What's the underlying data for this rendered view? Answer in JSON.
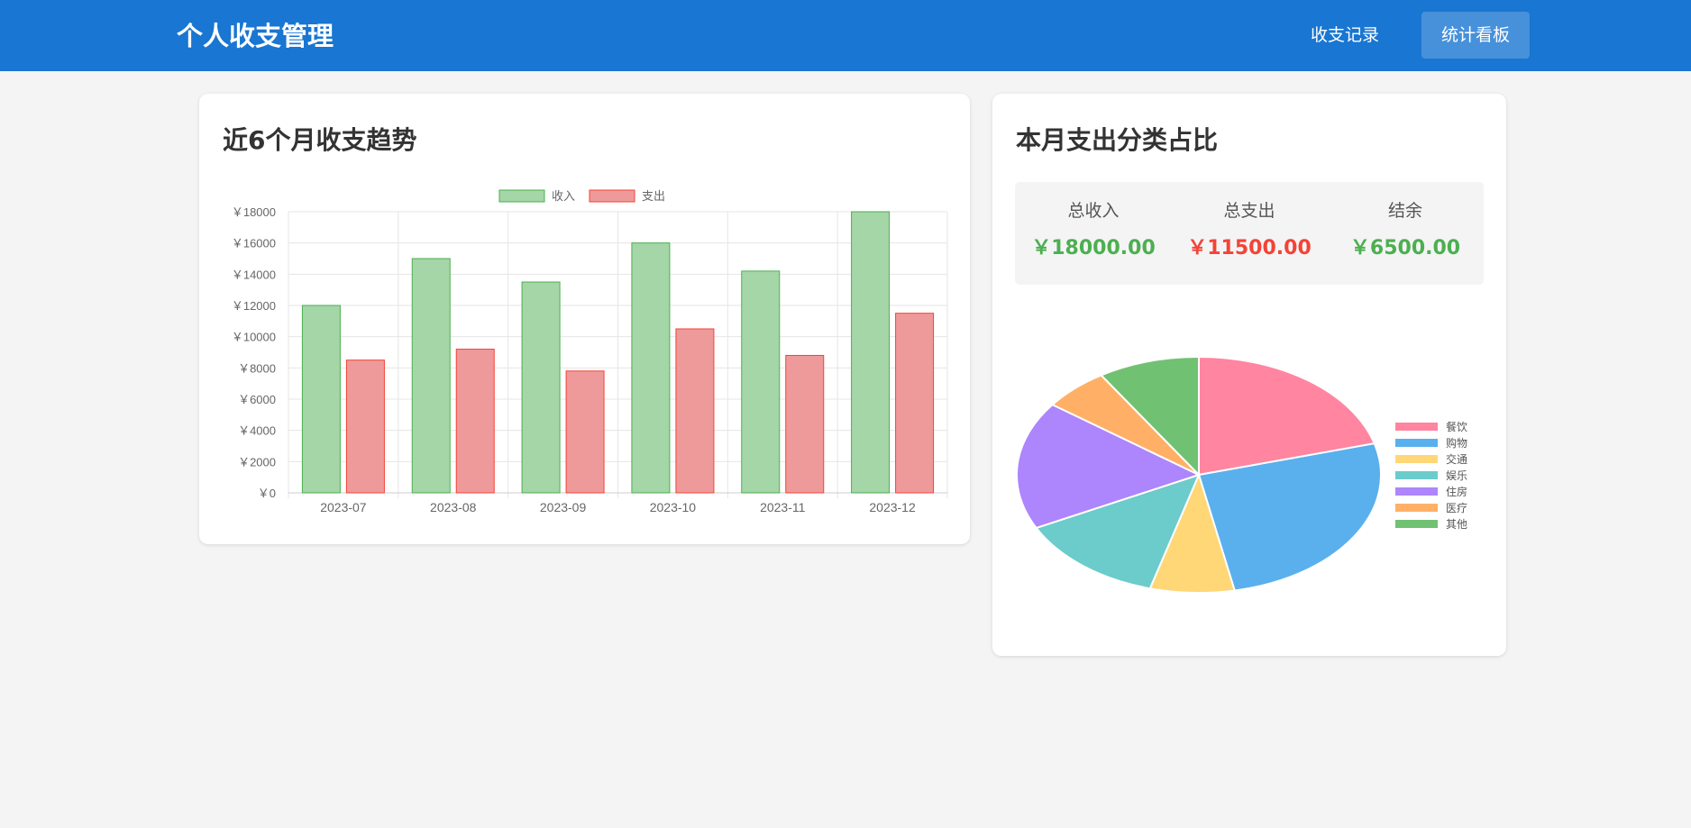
{
  "app": {
    "title": "个人收支管理",
    "nav": {
      "records": "收支记录",
      "dashboard": "统计看板"
    }
  },
  "trend": {
    "title": "近6个月收支趋势"
  },
  "monthly": {
    "title": "本月支出分类占比",
    "summary": {
      "income_label": "总收入",
      "income_value": "￥18000.00",
      "expense_label": "总支出",
      "expense_value": "￥11500.00",
      "balance_label": "结余",
      "balance_value": "￥6500.00"
    }
  },
  "colors": {
    "brand": "#1976d2",
    "income": "#4caf50",
    "expense": "#f44336"
  },
  "chart_data": [
    {
      "type": "bar",
      "categories": [
        "2023-07",
        "2023-08",
        "2023-09",
        "2023-10",
        "2023-11",
        "2023-12"
      ],
      "series": [
        {
          "name": "收入",
          "values": [
            12000,
            15000,
            13500,
            16000,
            14200,
            18000
          ],
          "fill": "#a5d6a7",
          "stroke": "#4caf50"
        },
        {
          "name": "支出",
          "values": [
            8500,
            9200,
            7800,
            10500,
            8800,
            11500
          ],
          "fill": "#ef9a9a",
          "stroke": "#f44336"
        }
      ],
      "ylim": [
        0,
        18000
      ],
      "y_ticks": [
        0,
        2000,
        4000,
        6000,
        8000,
        10000,
        12000,
        14000,
        16000,
        18000
      ],
      "y_tick_prefix": "￥",
      "grid": true,
      "legend": "top"
    },
    {
      "type": "pie",
      "labels": [
        "餐饮",
        "购物",
        "交通",
        "娱乐",
        "住房",
        "医疗",
        "其他"
      ],
      "values": [
        2300,
        2900,
        830,
        1470,
        1950,
        650,
        1000
      ],
      "colors": [
        "#ff85a1",
        "#5ab0ed",
        "#ffd776",
        "#6ccbcb",
        "#ad85fc",
        "#ffb066",
        "#71c173"
      ],
      "legend": "right"
    }
  ]
}
